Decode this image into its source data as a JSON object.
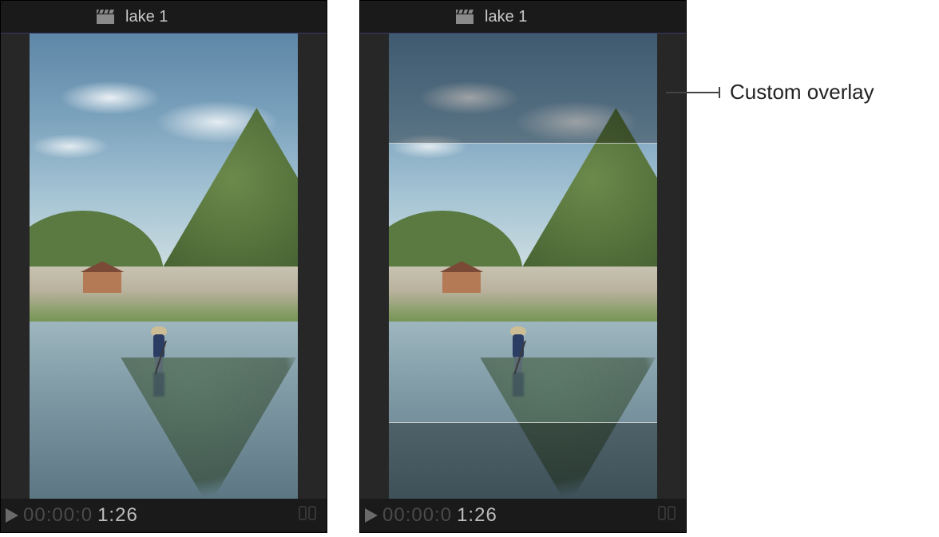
{
  "viewers": [
    {
      "clip_name": "lake 1",
      "timecode_dim": "00:00:0",
      "timecode_bright": "1:26",
      "has_overlay": false
    },
    {
      "clip_name": "lake 1",
      "timecode_dim": "00:00:0",
      "timecode_bright": "1:26",
      "has_overlay": true
    }
  ],
  "callout": {
    "label": "Custom overlay"
  },
  "icons": {
    "clapper": "clapper-icon",
    "play": "play-icon",
    "loop": "loop-icon"
  }
}
